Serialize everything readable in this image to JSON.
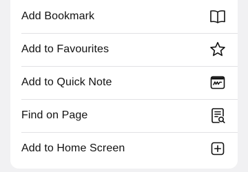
{
  "menu": {
    "items": [
      {
        "label": "Add Bookmark",
        "icon": "book-icon"
      },
      {
        "label": "Add to Favourites",
        "icon": "star-icon"
      },
      {
        "label": "Add to Quick Note",
        "icon": "quick-note-icon"
      },
      {
        "label": "Find on Page",
        "icon": "find-document-icon"
      },
      {
        "label": "Add to Home Screen",
        "icon": "plus-square-icon"
      }
    ]
  },
  "colors": {
    "background": "#f1f1f3",
    "sheet": "#ffffff",
    "text": "#111111",
    "separator": "#e1e1e4"
  }
}
